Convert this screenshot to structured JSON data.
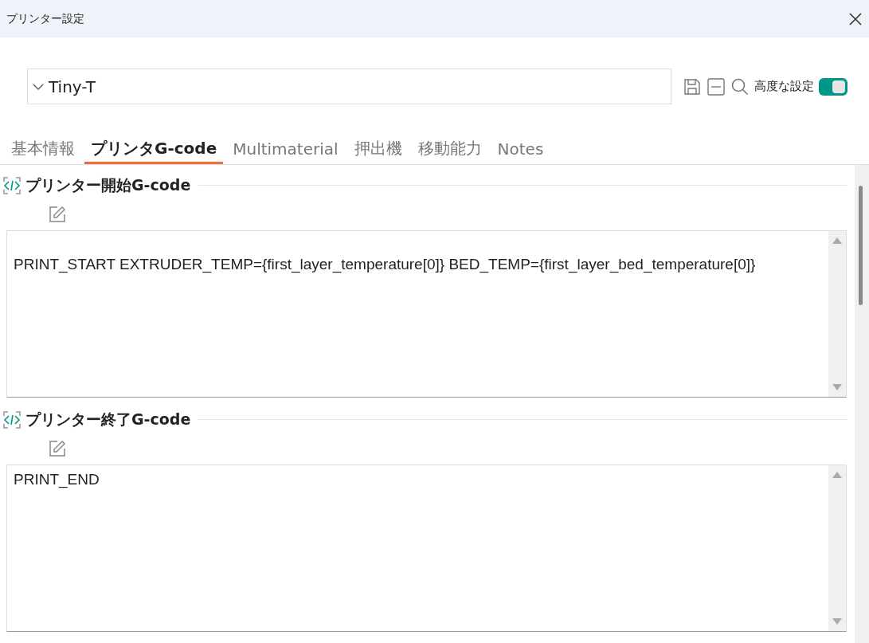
{
  "window": {
    "title": "プリンター設定"
  },
  "preset": {
    "value": "Tiny-T"
  },
  "advanced": {
    "label": "高度な設定",
    "on": true
  },
  "tabs": [
    {
      "label": "基本情報",
      "selected": false
    },
    {
      "label": "プリンタG-code",
      "selected": true
    },
    {
      "label": "Multimaterial",
      "selected": false
    },
    {
      "label": "押出機",
      "selected": false
    },
    {
      "label": "移動能力",
      "selected": false
    },
    {
      "label": "Notes",
      "selected": false
    }
  ],
  "sections": [
    {
      "title": "プリンター開始G-code",
      "value": "\nPRINT_START EXTRUDER_TEMP={first_layer_temperature[0]} BED_TEMP={first_layer_bed_temperature[0]}"
    },
    {
      "title": "プリンター終了G-code",
      "value": "PRINT_END"
    }
  ]
}
